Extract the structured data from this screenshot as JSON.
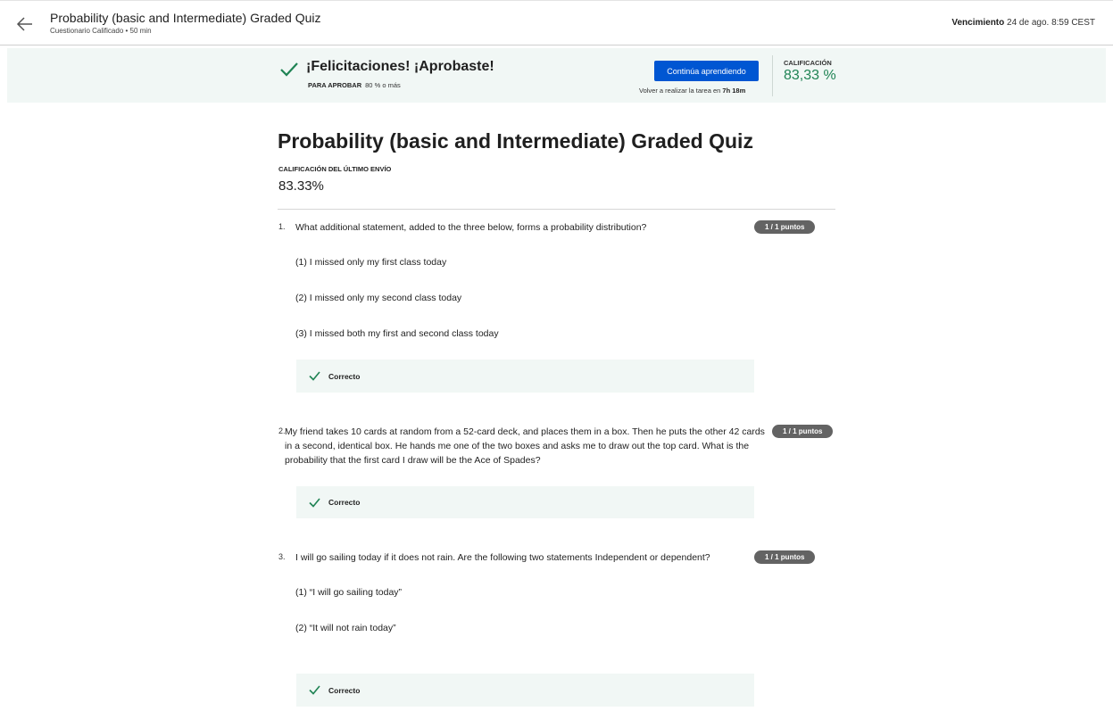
{
  "header": {
    "title": "Probability (basic and Intermediate) Graded Quiz",
    "subtitle": "Cuestionario Calificado • 50 min",
    "due_label": "Vencimiento",
    "due_value": "24 de ago. 8:59 CEST"
  },
  "banner": {
    "congrats": "¡Felicitaciones! ¡Aprobaste!",
    "pass_label": "PARA APROBAR",
    "pass_value": "80 % o más",
    "continue_label": "Continúa aprendiendo",
    "retry_prefix": "Volver a realizar la tarea en",
    "retry_time": "7h 18m",
    "grade_label": "CALIFICACIÓN",
    "grade_value": "83,33 %",
    "accent": "#1f8354",
    "button_color": "#0056d2"
  },
  "quiz": {
    "title": "Probability (basic and Intermediate) Graded Quiz",
    "last_label": "CALIFICACIÓN DEL ÚLTIMO ENVÍO",
    "last_value": "83.33%"
  },
  "questions": [
    {
      "number": "1.",
      "text": "What additional statement, added to the three below, forms a probability distribution?",
      "points": "1 / 1 puntos",
      "options": [
        "(1) I missed only my first class today",
        "(2) I missed only my second class today",
        "(3) I missed both my first and second class today"
      ],
      "result": "Correcto"
    },
    {
      "number": "2.",
      "text": "My friend takes 10 cards at random from a 52-card deck, and places them in a box. Then he puts the other 42 cards in a second, identical box. He hands me one of the two boxes and asks me to draw out the top card. What is the probability that the first card I draw will be the Ace of Spades?",
      "points": "1 / 1 puntos",
      "options": [],
      "result": "Correcto"
    },
    {
      "number": "3.",
      "text": "I will go sailing today if it does not rain. Are the following two statements Independent or dependent?",
      "points": "1 / 1 puntos",
      "options": [
        "(1) “I will go sailing today”",
        "(2) “It will not rain today”"
      ],
      "result": "Correcto"
    }
  ]
}
